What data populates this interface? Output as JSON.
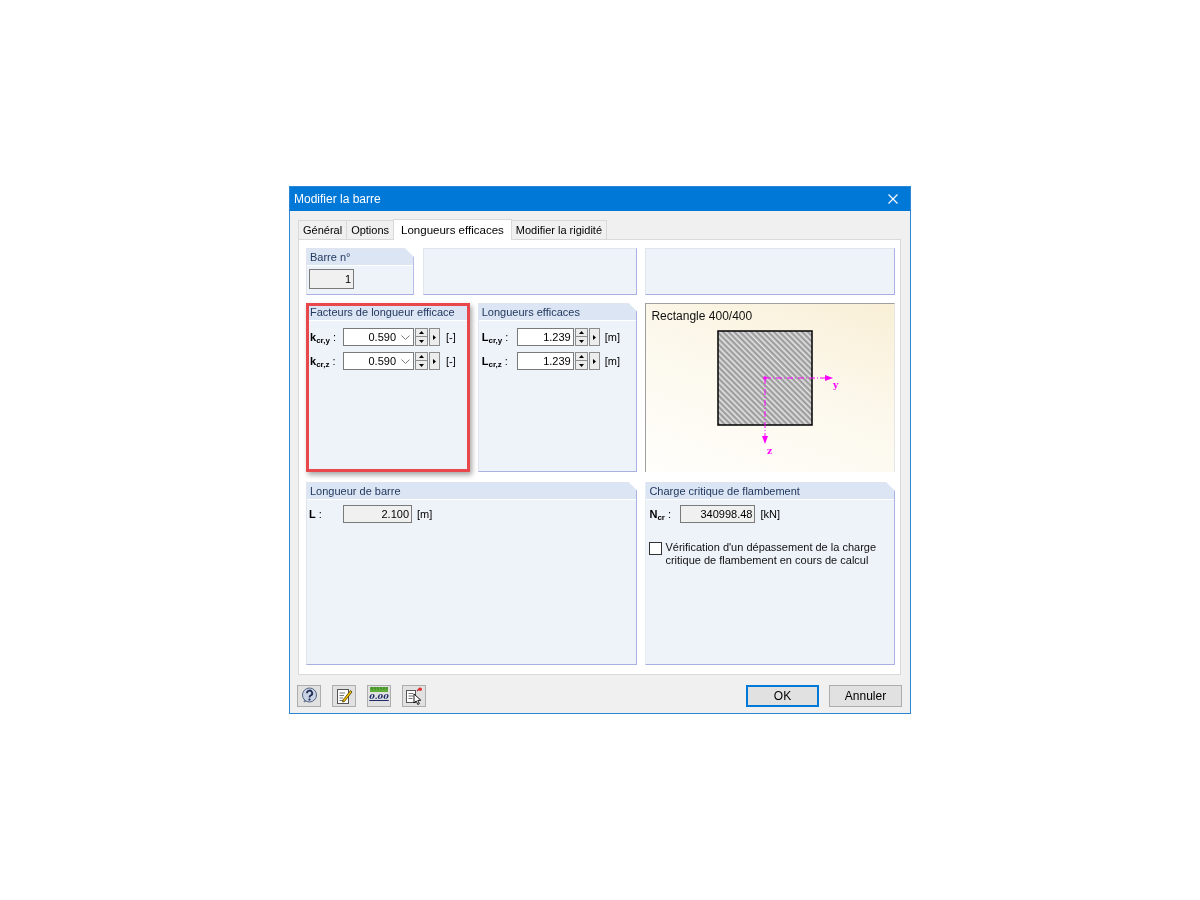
{
  "window": {
    "title": "Modifier la barre"
  },
  "tabs": [
    {
      "label": "Général",
      "selected": false
    },
    {
      "label": "Options",
      "selected": false
    },
    {
      "label": "Longueurs efficaces",
      "selected": true
    },
    {
      "label": "Modifier la rigidité",
      "selected": false
    }
  ],
  "bar_number": {
    "title": "Barre n°",
    "value": "1",
    "readonly": true
  },
  "factors": {
    "title": "Facteurs de longueur efficace",
    "highlighted": true,
    "rows": [
      {
        "label": "**k**$_{cr,y}$ :",
        "value": "0.590",
        "unit": "[-]",
        "readonly": false
      },
      {
        "label": "**k**$_{cr,z}$ :",
        "value": "0.590",
        "unit": "[-]",
        "readonly": false
      }
    ]
  },
  "effective_lengths": {
    "title": "Longueurs efficaces",
    "rows": [
      {
        "label": "**L**$_{cr,y}$ :",
        "value": "1.239",
        "unit": "[m]",
        "readonly": false
      },
      {
        "label": "**L**$_{cr,z}$ :",
        "value": "1.239",
        "unit": "[m]",
        "readonly": false
      }
    ]
  },
  "section": {
    "title": "Rectangle 400/400",
    "axis_y": "y",
    "axis_z": "z"
  },
  "bar_length": {
    "title": "Longueur de barre",
    "label": "**L** :",
    "value": "2.100",
    "unit": "[m]",
    "readonly": true
  },
  "critical_load": {
    "title": "Charge critique de flambement",
    "label": "**N**$_{cr}$ :",
    "value": "340998.48",
    "unit": "[kN]",
    "readonly": true,
    "check": {
      "label": "Vérification d'un dépassement de la charge critique de flambement en cours de calcul",
      "checked": false
    }
  },
  "footer": {
    "format_sample": "0.00",
    "buttons": [
      {
        "label": "OK",
        "default": true
      },
      {
        "label": "Annuler",
        "default": false
      }
    ]
  }
}
